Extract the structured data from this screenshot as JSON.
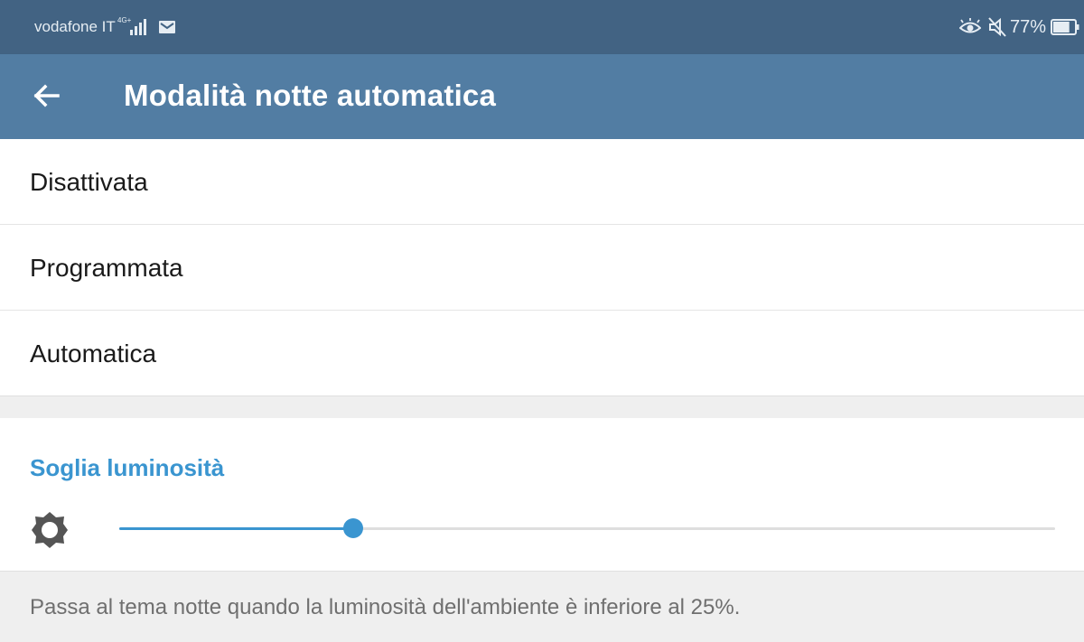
{
  "status_bar": {
    "carrier": "vodafone IT",
    "network_type": "4G+",
    "battery_percent": "77%",
    "battery_level": 0.77,
    "icons": [
      "signal-icon",
      "mail-icon",
      "eye-comfort-icon",
      "mute-icon",
      "battery-icon"
    ]
  },
  "app_bar": {
    "title": "Modalità notte automatica",
    "back_icon": "arrow-left-icon"
  },
  "options": [
    {
      "label": "Disattivata"
    },
    {
      "label": "Programmata"
    },
    {
      "label": "Automatica"
    }
  ],
  "threshold": {
    "title": "Soglia luminosità",
    "icon": "brightness-icon",
    "value": 0.25
  },
  "footer": {
    "description": "Passa al tema notte quando la luminosità dell'ambiente è inferiore al 25%."
  },
  "colors": {
    "status_bar": "#426383",
    "app_bar": "#527da3",
    "accent": "#3a95d0"
  }
}
